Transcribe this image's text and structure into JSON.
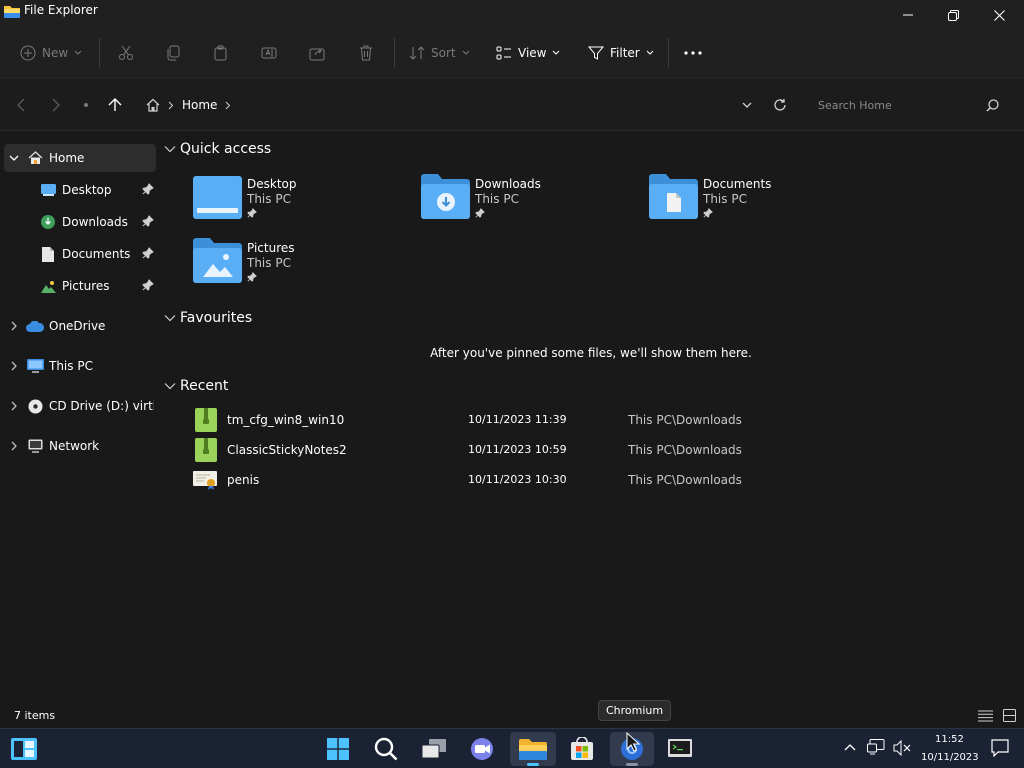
{
  "window": {
    "title": "File Explorer"
  },
  "toolbar": {
    "new_label": "New",
    "sort_label": "Sort",
    "view_label": "View",
    "filter_label": "Filter"
  },
  "address": {
    "crumbs": [
      "Home"
    ],
    "search_placeholder": "Search Home"
  },
  "sidebar": {
    "items": [
      {
        "label": "Home"
      },
      {
        "label": "Desktop"
      },
      {
        "label": "Downloads"
      },
      {
        "label": "Documents"
      },
      {
        "label": "Pictures"
      },
      {
        "label": "OneDrive"
      },
      {
        "label": "This PC"
      },
      {
        "label": "CD Drive (D:) virtio-w"
      },
      {
        "label": "Network"
      }
    ]
  },
  "main": {
    "quick_access": {
      "heading": "Quick access",
      "items": [
        {
          "name": "Desktop",
          "location": "This PC"
        },
        {
          "name": "Downloads",
          "location": "This PC"
        },
        {
          "name": "Documents",
          "location": "This PC"
        },
        {
          "name": "Pictures",
          "location": "This PC"
        }
      ]
    },
    "favourites": {
      "heading": "Favourites",
      "empty_message": "After you've pinned some files, we'll show them here."
    },
    "recent": {
      "heading": "Recent",
      "rows": [
        {
          "name": "tm_cfg_win8_win10",
          "date": "10/11/2023 11:39",
          "location": "This PC\\Downloads"
        },
        {
          "name": "ClassicStickyNotes2",
          "date": "10/11/2023 10:59",
          "location": "This PC\\Downloads"
        },
        {
          "name": "penis",
          "date": "10/11/2023 10:30",
          "location": "This PC\\Downloads"
        }
      ]
    }
  },
  "statusbar": {
    "item_count": "7 items"
  },
  "tooltip": {
    "text": "Chromium"
  },
  "taskbar": {
    "time": "11:52",
    "date": "10/11/2023"
  },
  "colors": {
    "accent": "#4cc2ff",
    "folder": "#5aaef5",
    "background": "#191919",
    "taskbar": "#1b2233"
  }
}
